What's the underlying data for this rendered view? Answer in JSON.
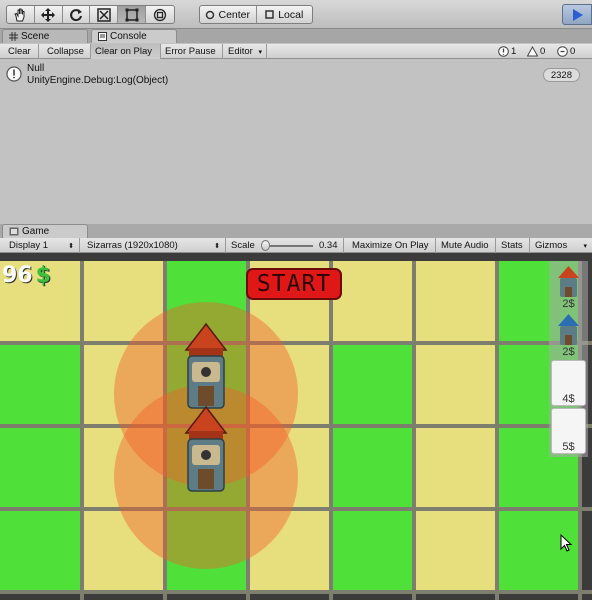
{
  "toolbar": {
    "tools": [
      "hand-icon",
      "move-icon",
      "rotate-icon",
      "scale-icon",
      "rect-icon",
      "transform-icon"
    ],
    "pivot_center": "Center",
    "pivot_local": "Local"
  },
  "scene_tab": "Scene",
  "console_tab": "Console",
  "console": {
    "buttons": [
      "Clear",
      "Collapse",
      "Clear on Play",
      "Error Pause",
      "Editor"
    ],
    "log_count": "1",
    "warn_count": "0",
    "error_count": "0",
    "entry": {
      "line1": "Null",
      "line2": "UnityEngine.Debug:Log(Object)",
      "count": "2328"
    }
  },
  "game_tab": "Game",
  "game_bar": {
    "display": "Display 1",
    "resolution": "Sizarras (1920x1080)",
    "scale_label": "Scale",
    "scale_value": "0.34",
    "maximize": "Maximize On Play",
    "mute": "Mute Audio",
    "stats": "Stats",
    "gizmos": "Gizmos"
  },
  "game": {
    "money": "96",
    "money_sign": "$",
    "start_label": "START",
    "shop_prices": [
      "2$",
      "2$",
      "4$",
      "5$"
    ]
  },
  "colors": {
    "sand": "#e7df7e",
    "grass": "#4fe03a",
    "start_red": "#e01717",
    "range": "#f35c28"
  }
}
